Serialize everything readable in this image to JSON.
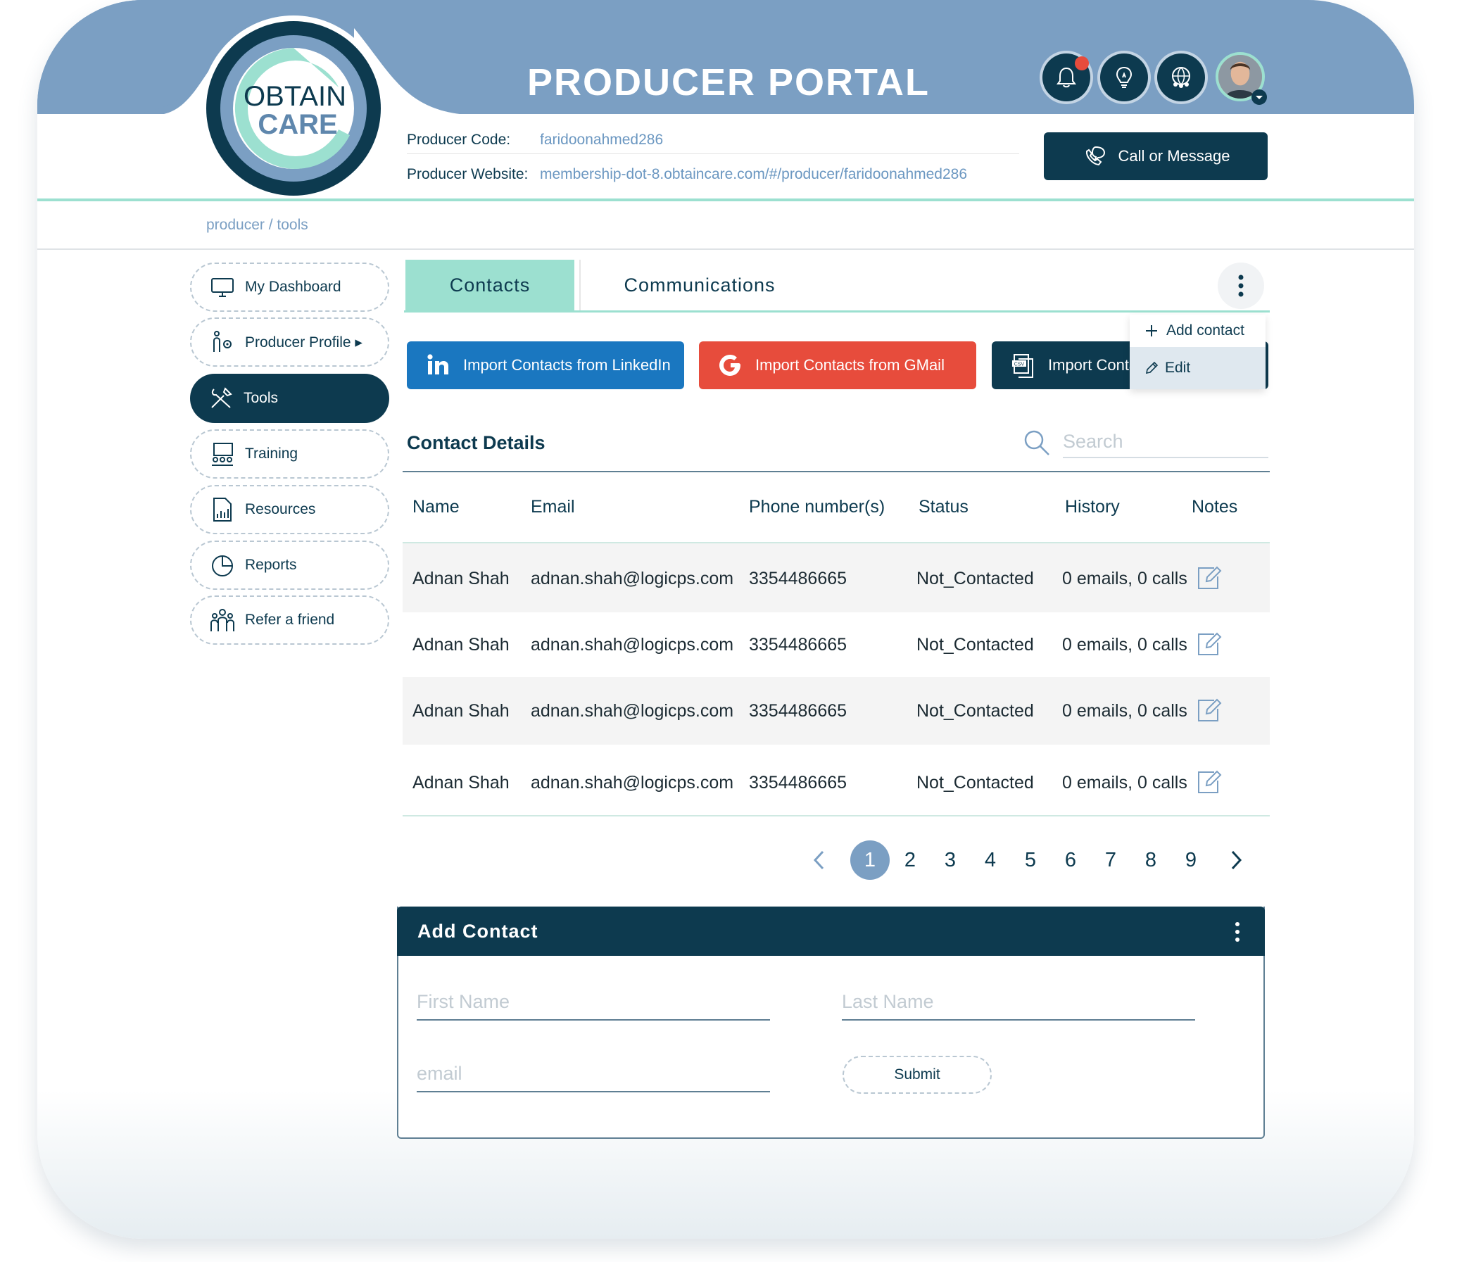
{
  "brand": {
    "logo_top": "OBTAIN",
    "logo_bottom": "CARE",
    "colors": {
      "navy": "#0d3a4f",
      "teal": "#9ce0d0",
      "steel_blue": "#7b9fc3",
      "linkedin": "#1a77c0",
      "gmail": "#e74c3c"
    }
  },
  "header": {
    "title": "PRODUCER PORTAL",
    "icons": [
      "bell-icon",
      "lightbulb-icon",
      "globe-people-icon"
    ],
    "has_notification": true,
    "avatar_icon": "user-avatar"
  },
  "producer": {
    "code_label": "Producer Code:",
    "code_value": "faridoonahmed286",
    "website_label": "Producer Website:",
    "website_value": "membership-dot-8.obtaincare.com/#/producer/faridoonahmed286"
  },
  "call_button": {
    "label": "Call or Message",
    "icon": "phone-chat-icon"
  },
  "breadcrumb": "producer / tools",
  "sidebar": {
    "items": [
      {
        "label": "My Dashboard",
        "icon": "monitor-icon",
        "active": false
      },
      {
        "label": "Producer Profile ▸",
        "icon": "profile-gear-icon",
        "active": false
      },
      {
        "label": "Tools",
        "icon": "tools-icon",
        "active": true
      },
      {
        "label": "Training",
        "icon": "training-icon",
        "active": false
      },
      {
        "label": "Resources",
        "icon": "document-chart-icon",
        "active": false
      },
      {
        "label": "Reports",
        "icon": "pie-chart-icon",
        "active": false
      },
      {
        "label": "Refer a friend",
        "icon": "group-icon",
        "active": false
      }
    ]
  },
  "tabs": [
    {
      "label": "Contacts",
      "active": true
    },
    {
      "label": "Communications",
      "active": false
    }
  ],
  "import": {
    "linkedin": "Import Contacts from LinkedIn",
    "gmail": "Import Contacts from GMail",
    "csv": "Import Contacts from CSV"
  },
  "menu": {
    "add": "Add contact",
    "edit": "Edit"
  },
  "contact_details": {
    "title": "Contact Details",
    "search_placeholder": "Search",
    "columns": [
      "Name",
      "Email",
      "Phone number(s)",
      "Status",
      "History",
      "Notes"
    ],
    "rows": [
      {
        "name": "Adnan Shah",
        "email": "adnan.shah@logicps.com",
        "phone": "3354486665",
        "status": "Not_Contacted",
        "history": "0 emails, 0 calls"
      },
      {
        "name": "Adnan Shah",
        "email": "adnan.shah@logicps.com",
        "phone": "3354486665",
        "status": "Not_Contacted",
        "history": "0 emails, 0 calls"
      },
      {
        "name": "Adnan Shah",
        "email": "adnan.shah@logicps.com",
        "phone": "3354486665",
        "status": "Not_Contacted",
        "history": "0 emails, 0 calls"
      },
      {
        "name": "Adnan Shah",
        "email": "adnan.shah@logicps.com",
        "phone": "3354486665",
        "status": "Not_Contacted",
        "history": "0 emails, 0 calls"
      }
    ]
  },
  "pagination": {
    "pages": [
      "1",
      "2",
      "3",
      "4",
      "5",
      "6",
      "7",
      "8",
      "9"
    ],
    "current": "1"
  },
  "add_contact": {
    "title": "Add Contact",
    "first_name_placeholder": "First Name",
    "last_name_placeholder": "Last Name",
    "email_placeholder": "email",
    "submit": "Submit"
  }
}
